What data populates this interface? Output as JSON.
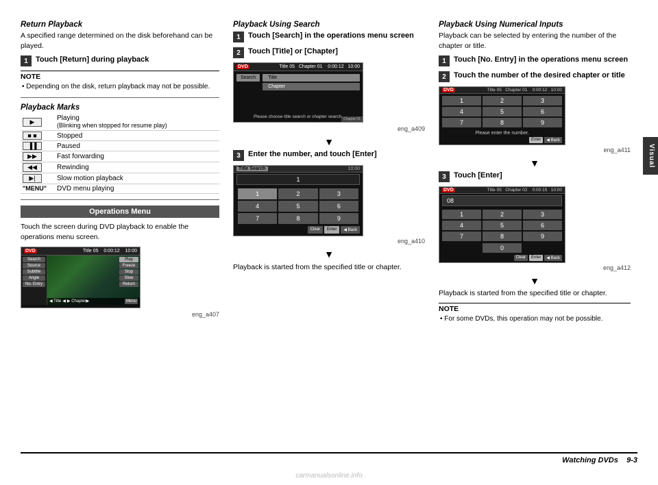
{
  "page": {
    "footer": {
      "title": "Watching DVDs",
      "page_num": "9-3"
    },
    "visual_tab": "Visual"
  },
  "left_col": {
    "return_playback": {
      "title": "Return Playback",
      "text": "A specified range determined on the disk beforehand can be played.",
      "step1": {
        "num": "1",
        "text": "Touch [Return] during playback"
      },
      "note": {
        "title": "NOTE",
        "text": "Depending on the disk, return playback may not be possible."
      }
    },
    "playback_marks": {
      "title": "Playback Marks",
      "marks": [
        {
          "icon": "▶",
          "label": "Playing\n(Blinking when stopped for resume play)"
        },
        {
          "icon": "■",
          "label": "Stopped"
        },
        {
          "icon": "⏸",
          "label": "Paused"
        },
        {
          "icon": "▶▶",
          "label": "Fast forwarding"
        },
        {
          "icon": "◀◀",
          "label": "Rewinding"
        },
        {
          "icon": "▶|",
          "label": "Slow motion playback"
        },
        {
          "icon": "MENU",
          "label": "DVD menu playing"
        }
      ]
    },
    "ops_menu": {
      "header": "Operations Menu",
      "text": "Touch the screen during DVD playback to enable the operations menu screen.",
      "image_caption": "eng_a407"
    }
  },
  "mid_col": {
    "title": "Playback Using Search",
    "step1": {
      "num": "1",
      "text": "Touch [Search] in the operations menu screen"
    },
    "step2": {
      "num": "2",
      "text": "Touch [Title] or [Chapter]"
    },
    "screen1_caption": "eng_a409",
    "step3": {
      "num": "3",
      "text": "Enter the number, and touch [Enter]"
    },
    "screen2_caption": "eng_a410",
    "playback_note": "Playback is started from the specified title or chapter."
  },
  "right_col": {
    "title": "Playback Using Numerical Inputs",
    "text": "Playback can be selected by entering the number of the chapter or title.",
    "step1": {
      "num": "1",
      "text": "Touch [No. Entry] in the operations menu screen"
    },
    "step2": {
      "num": "2",
      "text": "Touch the number of the desired chapter or title"
    },
    "screen1_caption": "eng_a411",
    "step3": {
      "num": "3",
      "text": "Touch [Enter]"
    },
    "screen2_caption": "eng_a412",
    "playback_note": "Playback is started from the specified title or chapter.",
    "note": {
      "title": "NOTE",
      "text": "For some DVDs, this operation may not be possible."
    }
  },
  "dvd_screens": {
    "topbar_dvd": "DVD",
    "title_05": "Title 05",
    "chapter_01": "Chapter 01",
    "chapter_02": "Chapter 02",
    "time_0012": "0:00:12",
    "time_0015": "0:00:15",
    "ratio": "10:00",
    "search_btn": "Search",
    "source_btn": "Source",
    "subtitle_btn": "Subtitle",
    "angle_btn": "Angle",
    "no_entry_btn": "No. Entry",
    "play_btn": "Play",
    "freeze_btn": "Freeze",
    "stop_btn": "Stop",
    "slow_btn": "Slow",
    "return_btn": "Return",
    "menu_btn": "Menu",
    "title_btn": "Title",
    "chapter_btn": "Chapter",
    "please_choose": "Please choose title search or chapter search.",
    "please_enter": "Please enter the number.",
    "title_search_label": "Title Search",
    "num_grid": [
      "1",
      "2",
      "3",
      "4",
      "5",
      "6",
      "7",
      "8",
      "9"
    ],
    "clear_btn": "Clear",
    "enter_btn": "Enter",
    "back_btn": "◀ Back",
    "display_val": "08"
  }
}
